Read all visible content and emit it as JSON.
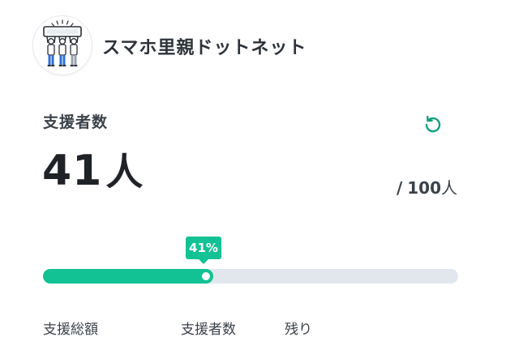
{
  "header": {
    "brand": "スマホ里親ドットネット",
    "logo_icon": "three-people-holding-phone-icon"
  },
  "supporters": {
    "label": "支援者数",
    "count": "41",
    "unit": "人",
    "goal_separator": "/",
    "goal_number": "100",
    "goal_unit": "人",
    "refresh_icon": "refresh-icon"
  },
  "progress": {
    "percent_label": "41%",
    "value": 0.41
  },
  "stats": {
    "labels": [
      "支援総額",
      "支援者数",
      "残り"
    ]
  },
  "colors": {
    "accent": "#12c294",
    "track": "#e2e7ee",
    "text_dark": "#1f2328",
    "text_muted": "#3b424a"
  }
}
